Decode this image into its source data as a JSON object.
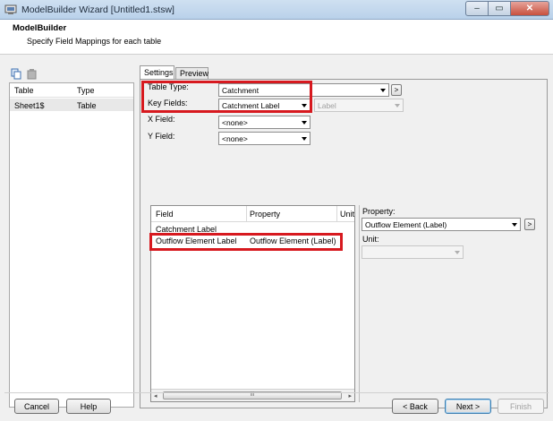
{
  "window": {
    "title": "ModelBuilder Wizard [Untitled1.stsw]",
    "minimize_glyph": "–",
    "maximize_glyph": "▭",
    "close_glyph": "✕"
  },
  "header": {
    "title": "ModelBuilder",
    "subtitle": "Specify Field Mappings for each table"
  },
  "table_list": {
    "columns": [
      "Table",
      "Type"
    ],
    "rows": [
      {
        "table": "Sheet1$",
        "type": "Table"
      }
    ]
  },
  "tabs": [
    {
      "label": "Settings",
      "active": true
    },
    {
      "label": "Preview",
      "active": false
    }
  ],
  "settings": {
    "table_type_label": "Table Type:",
    "table_type_value": "Catchment",
    "key_fields_label": "Key Fields:",
    "key_fields_value": "Catchment Label",
    "key_fields_secondary_value": "Label",
    "x_field_label": "X Field:",
    "x_field_value": "<none>",
    "y_field_label": "Y Field:",
    "y_field_value": "<none>",
    "more_glyph": ">"
  },
  "field_grid": {
    "columns": [
      "Field",
      "Property",
      "Unit"
    ],
    "rows": [
      {
        "field": "Catchment Label",
        "property": ""
      },
      {
        "field": "Outflow Element Label",
        "property": "Outflow Element (Label)"
      }
    ],
    "scroll_left": "◂",
    "scroll_right": "▸",
    "scroll_thumb": "III"
  },
  "property_panel": {
    "property_label": "Property:",
    "property_value": "Outflow Element (Label)",
    "unit_label": "Unit:",
    "unit_value": ""
  },
  "buttons": {
    "cancel": "Cancel",
    "help": "Help",
    "back": "< Back",
    "next": "Next >",
    "finish": "Finish"
  },
  "colors": {
    "highlight": "#d7191f",
    "titlebar": "#c4d8ee"
  }
}
